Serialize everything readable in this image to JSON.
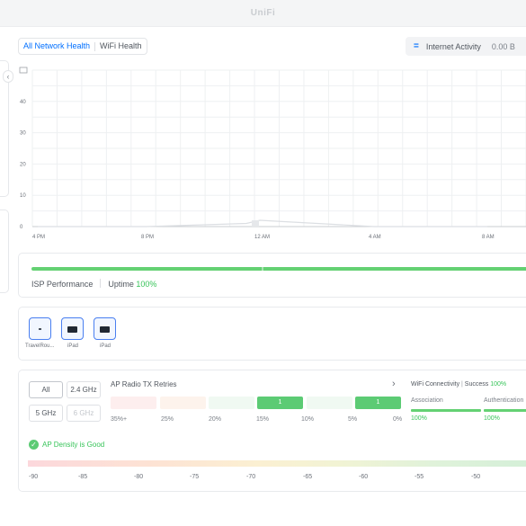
{
  "app": {
    "title": "UniFi"
  },
  "header": {
    "tabs": [
      {
        "label": "All Network Health",
        "active": true
      },
      {
        "label": "WiFi Health",
        "active": false
      }
    ],
    "activity": {
      "icon": "equals-icon",
      "label": "Internet Activity",
      "value": "0.00 B"
    }
  },
  "chart_data": {
    "type": "area",
    "title": "",
    "ylabel": "",
    "y_ticks": [
      "40",
      "30",
      "20",
      "10",
      "0"
    ],
    "ylim": [
      0,
      50
    ],
    "x_ticks": [
      "4 PM",
      "8 PM",
      "12 AM",
      "4 AM",
      "8 AM"
    ],
    "grid": true,
    "series": [
      {
        "x": [
          "4 PM",
          "8 PM",
          "11 PM",
          "12 AM",
          "4 AM",
          "8 AM"
        ],
        "values": [
          0,
          0,
          1,
          2,
          0,
          0
        ]
      }
    ]
  },
  "isp": {
    "label": "ISP Performance",
    "uptime_label": "Uptime",
    "uptime_value": "100%"
  },
  "devices": [
    {
      "name": "TravelRou...",
      "icon": "router-icon"
    },
    {
      "name": "iPad",
      "icon": "tablet-icon"
    },
    {
      "name": "iPad",
      "icon": "tablet-icon"
    }
  ],
  "bands": {
    "all": "All",
    "g24": "2.4 GHz",
    "g5": "5 GHz",
    "g6": "6 GHz"
  },
  "tx_retries": {
    "title": "AP Radio TX Retries",
    "bins": [
      "35%+",
      "25%",
      "20%",
      "15%",
      "10%",
      "5%",
      "0%"
    ],
    "counts": [
      "",
      "",
      "",
      "1",
      "",
      "1"
    ]
  },
  "wifi_connectivity": {
    "label": "WiFi Connectivity",
    "success_label": "Success",
    "success_value": "100%",
    "association_label": "Association",
    "association_value": "100%",
    "authentication_label": "Authentication",
    "authentication_value": "100%"
  },
  "density": {
    "label": "AP Density is Good"
  },
  "dbm_scale": [
    "-90",
    "-85",
    "-80",
    "-75",
    "-70",
    "-65",
    "-60",
    "-55",
    "-50"
  ],
  "colors": {
    "accent": "#006fff",
    "success": "#38c45a",
    "bar": "#64d173"
  }
}
